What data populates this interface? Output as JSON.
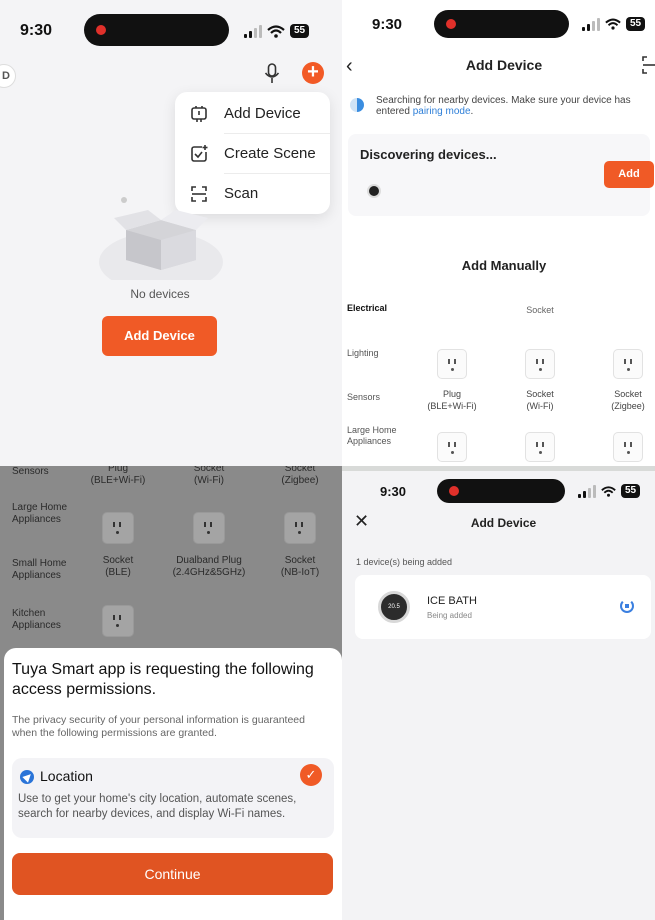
{
  "status_bar": {
    "time": "9:30",
    "battery": "55"
  },
  "home_screen": {
    "avatar_letter": "D",
    "menu": [
      {
        "label": "Add Device",
        "icon": "device-icon"
      },
      {
        "label": "Create Scene",
        "icon": "scene-icon"
      },
      {
        "label": "Scan",
        "icon": "scan-icon"
      }
    ],
    "empty_text": "No devices",
    "add_button": "Add Device"
  },
  "add_device_screen": {
    "back": "‹",
    "title": "Add Device",
    "searching_text": "Searching for nearby devices. Make sure your device has entered ",
    "pairing_link": "pairing mode",
    "period": ".",
    "discovering": "Discovering devices...",
    "add_button": "Add",
    "add_manually": "Add Manually",
    "categories": [
      "Electrical",
      "Lighting",
      "Sensors",
      "Large Home Appliances"
    ],
    "column_heading": "Socket",
    "devices": [
      {
        "line1": "Plug",
        "line2": "(BLE+Wi-Fi)"
      },
      {
        "line1": "Socket",
        "line2": "(Wi-Fi)"
      },
      {
        "line1": "Socket",
        "line2": "(Zigbee)"
      }
    ]
  },
  "permission_screen": {
    "bg_partial_row": [
      "Sensors",
      "Plug",
      "Socket",
      "Socket"
    ],
    "bg_partial_sub": [
      "(BLE+Wi-Fi)",
      "(Wi-Fi)",
      "(Zigbee)"
    ],
    "bg_categories": [
      "Large Home Appliances",
      "Small Home Appliances",
      "Kitchen Appliances"
    ],
    "bg_devices": [
      {
        "line1": "Socket",
        "line2": "(BLE)"
      },
      {
        "line1": "Dualband Plug",
        "line2": "(2.4GHz&5GHz)"
      },
      {
        "line1": "Socket",
        "line2": "(NB-IoT)"
      }
    ],
    "title": "Tuya Smart app is requesting the following access permissions.",
    "subtitle": "The privacy security of your personal information is guaranteed when the following permissions are granted.",
    "permission_name": "Location",
    "permission_desc": "Use to get your home's city location, automate scenes, search for nearby devices, and display Wi-Fi names.",
    "continue_button": "Continue"
  },
  "adding_screen": {
    "close": "✕",
    "title": "Add Device",
    "count_text": "1 device(s) being added",
    "device_name": "ICE BATH",
    "device_state": "Being added",
    "thermo_reading": "20.5"
  },
  "colors": {
    "accent": "#f05a26",
    "link": "#2e7fd8",
    "permission_icon": "#2a74d8"
  }
}
